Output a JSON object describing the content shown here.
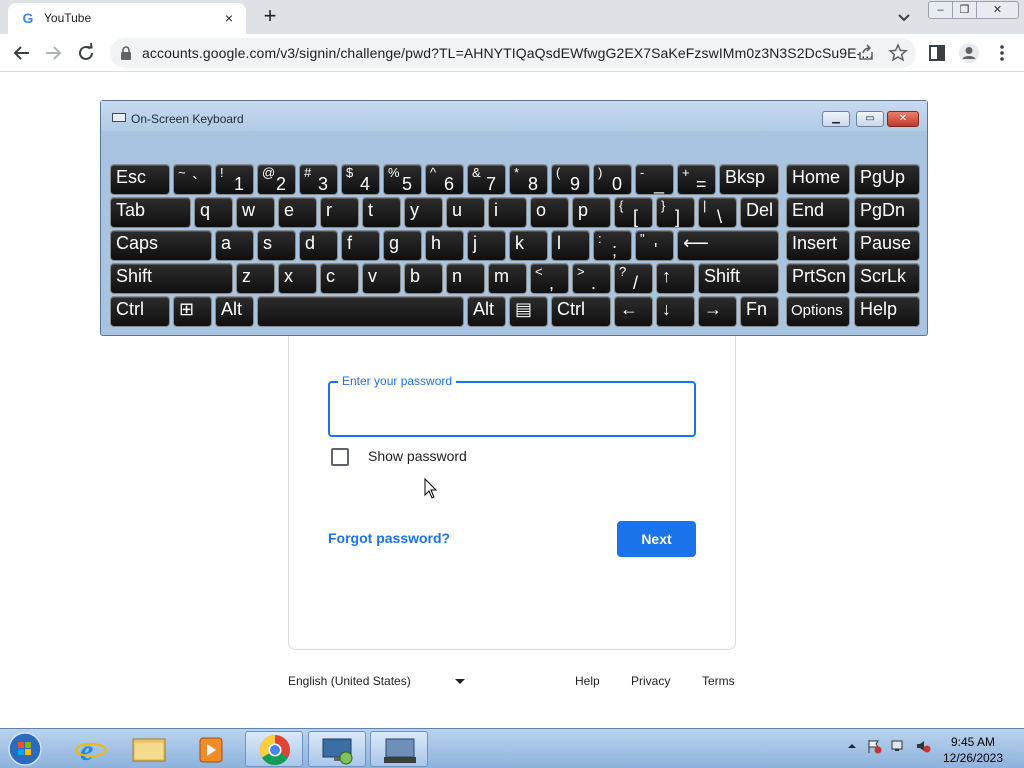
{
  "browser": {
    "tab_title": "YouTube",
    "tab_favicon": "G",
    "close_tab_icon": "×",
    "new_tab_icon": "+",
    "url": "accounts.google.com/v3/signin/challenge/pwd?TL=AHNYTIQaQsdEWfwgG2EX7SaKeFzswIMm0z3N3S2DcSu9E-...",
    "window_controls": {
      "minimize": "‒",
      "maximize": "❐",
      "close": "✕"
    }
  },
  "signin": {
    "password_label": "Enter your password",
    "password_value": "",
    "show_password_label": "Show password",
    "forgot_password": "Forgot password?",
    "next_button": "Next"
  },
  "footer": {
    "language": "English (United States)",
    "help": "Help",
    "privacy": "Privacy",
    "terms": "Terms"
  },
  "osk": {
    "title": "On-Screen Keyboard",
    "rows": [
      [
        {
          "label": "Esc"
        },
        {
          "shift": "~",
          "base": "`"
        },
        {
          "shift": "!",
          "base": "1"
        },
        {
          "shift": "@",
          "base": "2"
        },
        {
          "shift": "#",
          "base": "3"
        },
        {
          "shift": "$",
          "base": "4"
        },
        {
          "shift": "%",
          "base": "5"
        },
        {
          "shift": "^",
          "base": "6"
        },
        {
          "shift": "&",
          "base": "7"
        },
        {
          "shift": "*",
          "base": "8"
        },
        {
          "shift": "(",
          "base": "9"
        },
        {
          "shift": ")",
          "base": "0"
        },
        {
          "shift": "-",
          "base": "_"
        },
        {
          "shift": "+",
          "base": "="
        },
        {
          "label": "Bksp"
        },
        {
          "label": "Home"
        },
        {
          "label": "PgUp"
        }
      ],
      [
        {
          "label": "Tab"
        },
        {
          "label": "q"
        },
        {
          "label": "w"
        },
        {
          "label": "e"
        },
        {
          "label": "r"
        },
        {
          "label": "t"
        },
        {
          "label": "y"
        },
        {
          "label": "u"
        },
        {
          "label": "i"
        },
        {
          "label": "o"
        },
        {
          "label": "p"
        },
        {
          "shift": "{",
          "base": "["
        },
        {
          "shift": "}",
          "base": "]"
        },
        {
          "shift": "|",
          "base": "\\"
        },
        {
          "label": "Del"
        },
        {
          "label": "End"
        },
        {
          "label": "PgDn"
        }
      ],
      [
        {
          "label": "Caps"
        },
        {
          "label": "a"
        },
        {
          "label": "s"
        },
        {
          "label": "d"
        },
        {
          "label": "f"
        },
        {
          "label": "g"
        },
        {
          "label": "h"
        },
        {
          "label": "j"
        },
        {
          "label": "k"
        },
        {
          "label": "l"
        },
        {
          "shift": ":",
          "base": ";"
        },
        {
          "shift": "\"",
          "base": "'"
        },
        {
          "label": "⟵"
        },
        {
          "label": "Insert"
        },
        {
          "label": "Pause"
        }
      ],
      [
        {
          "label": "Shift"
        },
        {
          "label": "z"
        },
        {
          "label": "x"
        },
        {
          "label": "c"
        },
        {
          "label": "v"
        },
        {
          "label": "b"
        },
        {
          "label": "n"
        },
        {
          "label": "m"
        },
        {
          "shift": "<",
          "base": ","
        },
        {
          "shift": ">",
          "base": "."
        },
        {
          "shift": "?",
          "base": "/"
        },
        {
          "label": "↑"
        },
        {
          "label": "Shift"
        },
        {
          "label": "PrtScn"
        },
        {
          "label": "ScrLk"
        }
      ],
      [
        {
          "label": "Ctrl"
        },
        {
          "label": "⊞"
        },
        {
          "label": "Alt"
        },
        {
          "label": ""
        },
        {
          "label": "Alt"
        },
        {
          "label": "▤"
        },
        {
          "label": "Ctrl"
        },
        {
          "label": "←"
        },
        {
          "label": "↓"
        },
        {
          "label": "→"
        },
        {
          "label": "Fn"
        },
        {
          "label": "Options"
        },
        {
          "label": "Help"
        }
      ]
    ]
  },
  "taskbar": {
    "time": "9:45 AM",
    "date": "12/26/2023"
  }
}
